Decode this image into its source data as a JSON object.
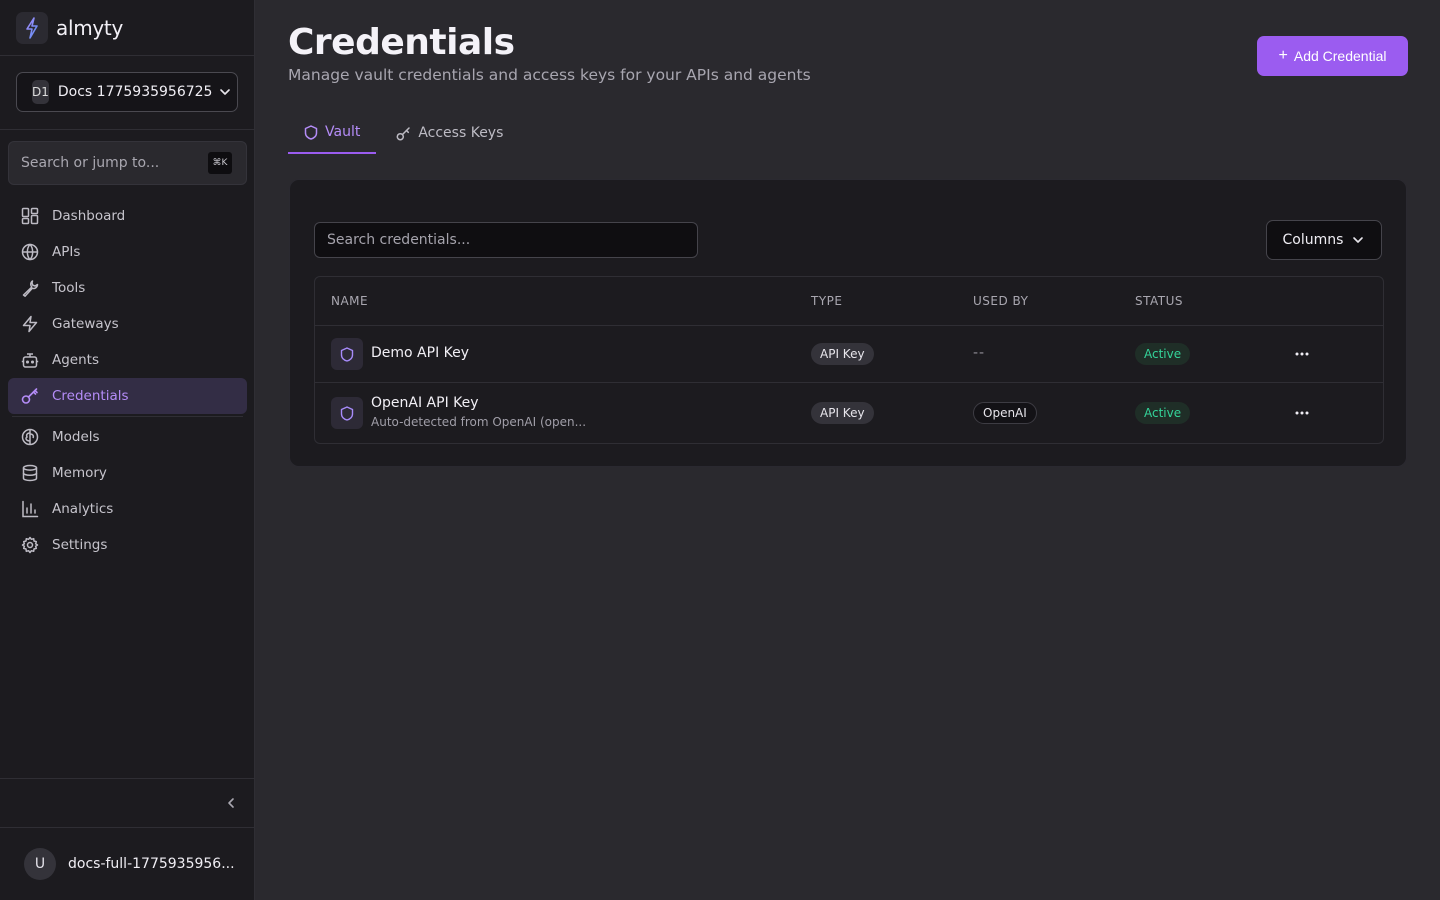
{
  "brand": {
    "name": "almyty"
  },
  "workspace": {
    "initials": "D1",
    "name": "Docs 1775935956725"
  },
  "search_jump": {
    "placeholder": "Search or jump to...",
    "shortcut": "⌘K"
  },
  "sidebar": {
    "items": [
      {
        "label": "Dashboard",
        "icon": "dashboard-icon"
      },
      {
        "label": "APIs",
        "icon": "globe-icon"
      },
      {
        "label": "Tools",
        "icon": "wrench-icon"
      },
      {
        "label": "Gateways",
        "icon": "zap-icon"
      },
      {
        "label": "Agents",
        "icon": "bot-icon"
      },
      {
        "label": "Credentials",
        "icon": "key-icon",
        "active": true
      },
      {
        "label": "Models",
        "icon": "brain-icon"
      },
      {
        "label": "Memory",
        "icon": "database-icon"
      },
      {
        "label": "Analytics",
        "icon": "bar-chart-icon"
      },
      {
        "label": "Settings",
        "icon": "gear-icon"
      }
    ]
  },
  "user": {
    "initial": "U",
    "name": "docs-full-1775935956..."
  },
  "page": {
    "title": "Credentials",
    "subtitle": "Manage vault credentials and access keys for your APIs and agents",
    "add_button": "Add Credential"
  },
  "tabs": [
    {
      "label": "Vault",
      "icon": "shield-icon",
      "active": true
    },
    {
      "label": "Access Keys",
      "icon": "key-icon",
      "active": false
    }
  ],
  "credentials": {
    "search_placeholder": "Search credentials...",
    "columns_button": "Columns",
    "headers": {
      "name": "NAME",
      "type": "TYPE",
      "used_by": "USED BY",
      "status": "STATUS"
    },
    "rows": [
      {
        "name": "Demo API Key",
        "description": "",
        "type": "API Key",
        "used_by": "--",
        "status": "Active"
      },
      {
        "name": "OpenAI API Key",
        "description": "Auto-detected from OpenAI (open...",
        "type": "API Key",
        "used_by": "OpenAI",
        "status": "Active"
      }
    ]
  },
  "colors": {
    "accent": "#9b5cf0",
    "accent_text": "#b48cf7",
    "status_active": "#34d399",
    "sidebar_bg": "#1c1b1f",
    "main_bg": "#2a292e"
  }
}
